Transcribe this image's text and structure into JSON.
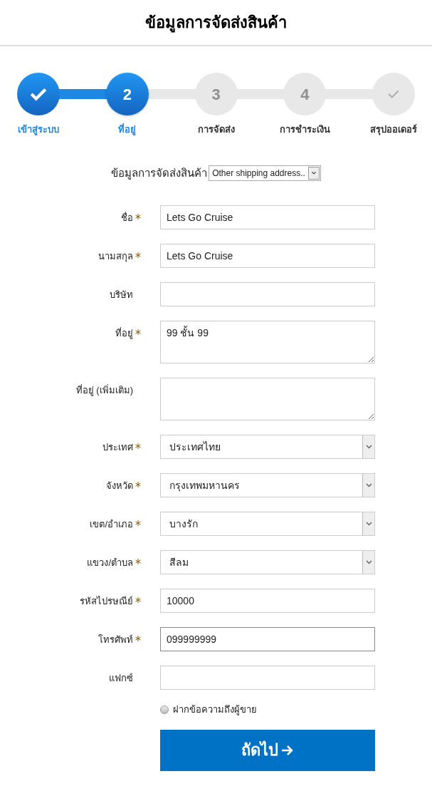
{
  "header": {
    "title": "ข้อมูลการจัดส่งสินค้า"
  },
  "steps": [
    {
      "kind": "check",
      "label": "เข้าสู่ระบบ",
      "selected": false
    },
    {
      "kind": "number",
      "number": "2",
      "label": "ที่อยู่",
      "selected": true
    },
    {
      "kind": "number",
      "number": "3",
      "label": "การจัดส่ง",
      "selected": false
    },
    {
      "kind": "number",
      "number": "4",
      "label": "การชำระเงิน",
      "selected": false
    },
    {
      "kind": "check",
      "label": "สรุปออเดอร์",
      "selected": false
    }
  ],
  "address_picker": {
    "label": "ข้อมูลการจัดส่งสินค้า",
    "value": "Other shipping address.."
  },
  "fields": [
    {
      "kind": "text",
      "label": "ชื่อ",
      "required": true,
      "value": "Lets Go Cruise"
    },
    {
      "kind": "text",
      "label": "นามสกุล",
      "required": true,
      "value": "Lets Go Cruise"
    },
    {
      "kind": "text",
      "label": "บริษัท",
      "required": false
    },
    {
      "kind": "textarea",
      "label": "ที่อยู่",
      "required": true,
      "value": "99 ชั้น 99"
    },
    {
      "kind": "textarea",
      "label": "ที่อยู่ (เพิ่มเติม)",
      "required": false
    },
    {
      "kind": "select",
      "label": "ประเทศ",
      "required": true,
      "value": "ประเทศไทย"
    },
    {
      "kind": "select",
      "label": "จังหวัด",
      "required": true,
      "value": "กรุงเทพมหานคร"
    },
    {
      "kind": "select",
      "label": "เขต/อำเภอ",
      "required": true,
      "value": "บางรัก"
    },
    {
      "kind": "select",
      "label": "แขวง/ตำบล",
      "required": true,
      "value": "สีลม"
    },
    {
      "kind": "text",
      "label": "รหัสไปรษณีย์",
      "required": true,
      "value": "10000"
    },
    {
      "kind": "text",
      "label": "โทรศัพท์",
      "required": true,
      "value": "099999999",
      "focused": true
    },
    {
      "kind": "text",
      "label": "แฟกซ์",
      "required": false
    }
  ],
  "message_option": {
    "label": "ฝากข้อความถึงผู้ขาย",
    "checked": false
  },
  "next_button": {
    "label": "ถัดไป"
  }
}
